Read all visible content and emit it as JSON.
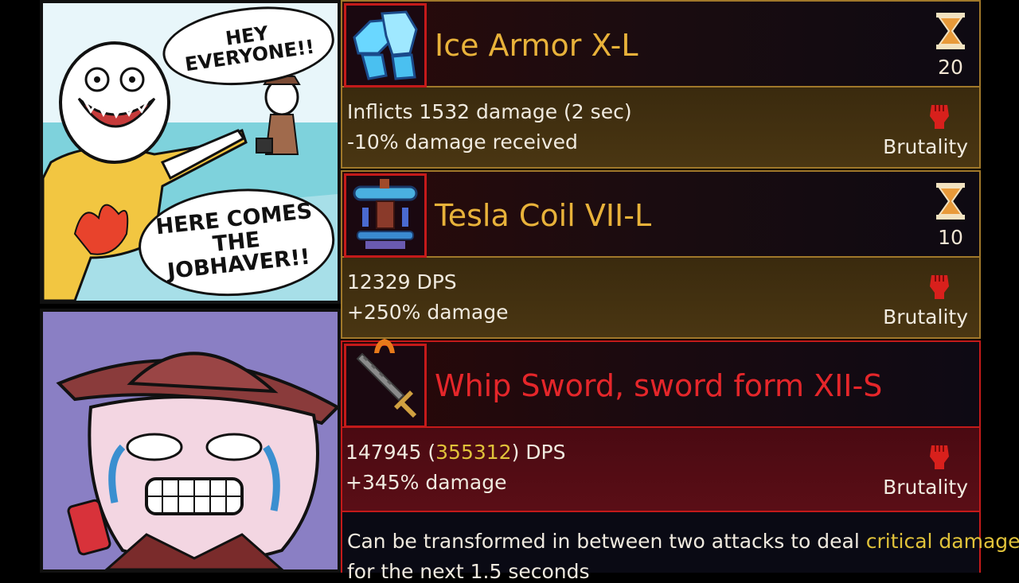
{
  "comic": {
    "bubble_top": "HEY EVERYONE!!",
    "bubble_bottom": "HERE COMES THE JOBHAVER!!"
  },
  "colors": {
    "legendary_frame": "#a0782a",
    "special_frame": "#c41a1a",
    "title_gold": "#e8b23a",
    "title_red": "#e5262a",
    "highlight_yellow": "#e0c23a",
    "brutality_red": "#d8201c"
  },
  "items": [
    {
      "icon": "ice-armor-icon",
      "title": "Ice Armor X-L",
      "cooldown": "20",
      "line1": "Inflicts 1532 damage (2 sec)",
      "line2": "-10% damage received",
      "category": "Brutality"
    },
    {
      "icon": "tesla-coil-icon",
      "title": "Tesla Coil VII-L",
      "cooldown": "10",
      "line1": "12329 DPS",
      "line2": "+250% damage",
      "category": "Brutality"
    },
    {
      "icon": "whip-sword-icon",
      "title": "Whip Sword, sword form XII-S",
      "dps_base": "147945",
      "dps_open": " (",
      "dps_crit": "355312",
      "dps_close": ") DPS",
      "line2": "+345% damage",
      "category": "Brutality",
      "note_prefix": "Can be transformed in between two attacks to deal ",
      "note_highlight": "critical damage",
      "note_suffix": "for the next 1.5 seconds"
    }
  ]
}
